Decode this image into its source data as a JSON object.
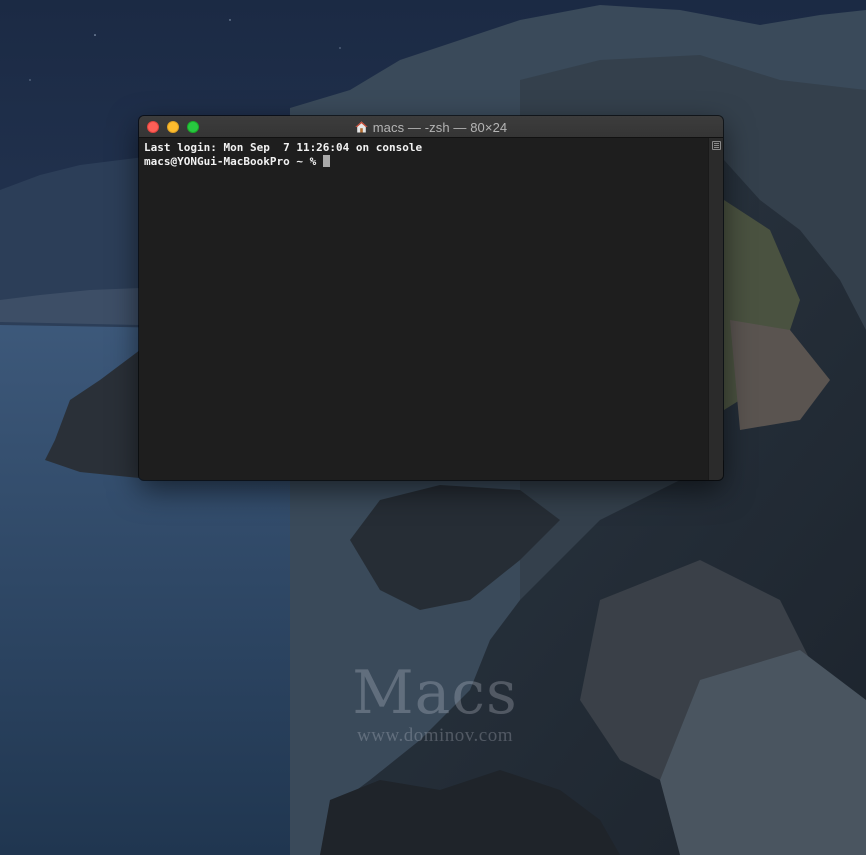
{
  "window": {
    "title": "macs — -zsh — 80×24",
    "title_icon": "house-icon"
  },
  "terminal": {
    "lines": [
      "Last login: Mon Sep  7 11:26:04 on console",
      "macs@YONGui-MacBookPro ~ % "
    ]
  },
  "watermark": {
    "logo": "Macs",
    "url": "www.dominov.com"
  },
  "colors": {
    "close": "#ff5f57",
    "minimize": "#febc2e",
    "zoom": "#28c840",
    "terminal_bg": "#1e1e1e",
    "terminal_text": "#f2f2f2"
  }
}
